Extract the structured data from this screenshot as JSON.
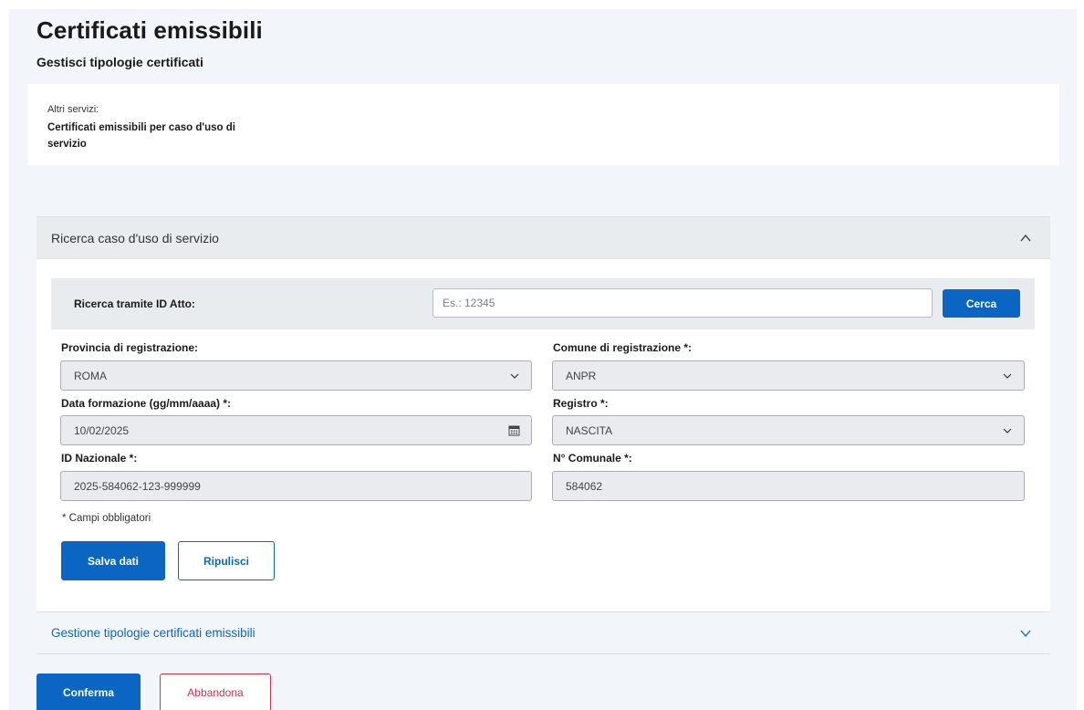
{
  "header": {
    "title": "Certificati emissibili",
    "subtitle": "Gestisci tipologie certificati"
  },
  "services": {
    "label": "Altri servizi:",
    "link": "Certificati emissibili per caso d'uso di servizio"
  },
  "accordion_search": {
    "label": "Ricerca caso d'uso di servizio",
    "icon": "chevron-up-icon",
    "expanded": true
  },
  "search": {
    "label": "Ricerca tramite ID Atto:",
    "placeholder": "Es.: 12345",
    "value": "",
    "button_label": "Cerca"
  },
  "form": {
    "provincia": {
      "label": "Provincia di registrazione:",
      "value": "ROMA"
    },
    "comune": {
      "label": "Comune di registrazione *:",
      "value": "ANPR"
    },
    "data": {
      "label": "Data formazione (gg/mm/aaaa) *:",
      "value": "10/02/2025",
      "icon": "calendar-icon"
    },
    "registro": {
      "label": "Registro *:",
      "value": "NASCITA"
    },
    "id_nazionale": {
      "label": "ID Nazionale *:",
      "value": "2025-584062-123-999999"
    },
    "n_comunale": {
      "label": "N° Comunale *:",
      "value": "584062"
    },
    "required_note": "* Campi obbligatori",
    "save_label": "Salva dati",
    "clear_label": "Ripulisci"
  },
  "accordion_manage": {
    "label": "Gestione tipologie certificati emissibili",
    "icon": "chevron-down-icon",
    "expanded": false
  },
  "footer": {
    "confirm_label": "Conferma",
    "abandon_label": "Abbandona"
  },
  "colors": {
    "primary": "#0b66c3",
    "danger": "#cc334d",
    "page_bg": "#f2f5f9",
    "strip_bg": "#e9ecef"
  }
}
